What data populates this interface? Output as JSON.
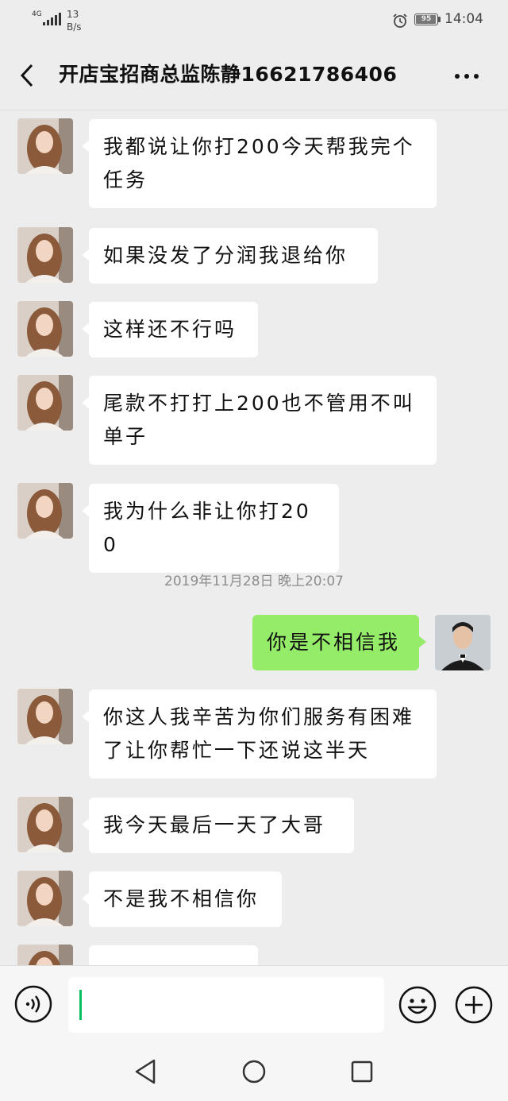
{
  "status_bar": {
    "network": "4G",
    "speed_value": "13",
    "speed_unit": "B/s",
    "battery_level": "95",
    "battery_percent": 95,
    "time": "14:04"
  },
  "header": {
    "title": "开店宝招商总监陈静16621786406",
    "back_icon": "back-chevron-icon",
    "more_icon": "more-dots-icon"
  },
  "messages": [
    {
      "side": "in",
      "text": "我都说让你打200今天帮我完个任务"
    },
    {
      "side": "in",
      "text": "如果没发了分润我退给你"
    },
    {
      "side": "in",
      "text": "这样还不行吗"
    },
    {
      "side": "in",
      "text": "尾款不打打上200也不管用不叫单子"
    },
    {
      "side": "in",
      "text": "我为什么非让你打200"
    },
    {
      "side": "out",
      "text": "你是不相信我"
    },
    {
      "side": "in",
      "text": "你这人我辛苦为你们服务有困难了让你帮忙一下还说这半天"
    },
    {
      "side": "in",
      "text": "我今天最后一天了大哥"
    },
    {
      "side": "in",
      "text": "不是我不相信你"
    }
  ],
  "timestamp": "2019年11月28日 晚上20:07",
  "input_bar": {
    "voice_icon": "voice-icon",
    "text_value": "",
    "emoji_icon": "emoji-icon",
    "plus_icon": "plus-icon"
  },
  "colors": {
    "background": "#ededed",
    "incoming_bubble": "#ffffff",
    "outgoing_bubble": "#95ec69",
    "caret": "#07c160"
  }
}
